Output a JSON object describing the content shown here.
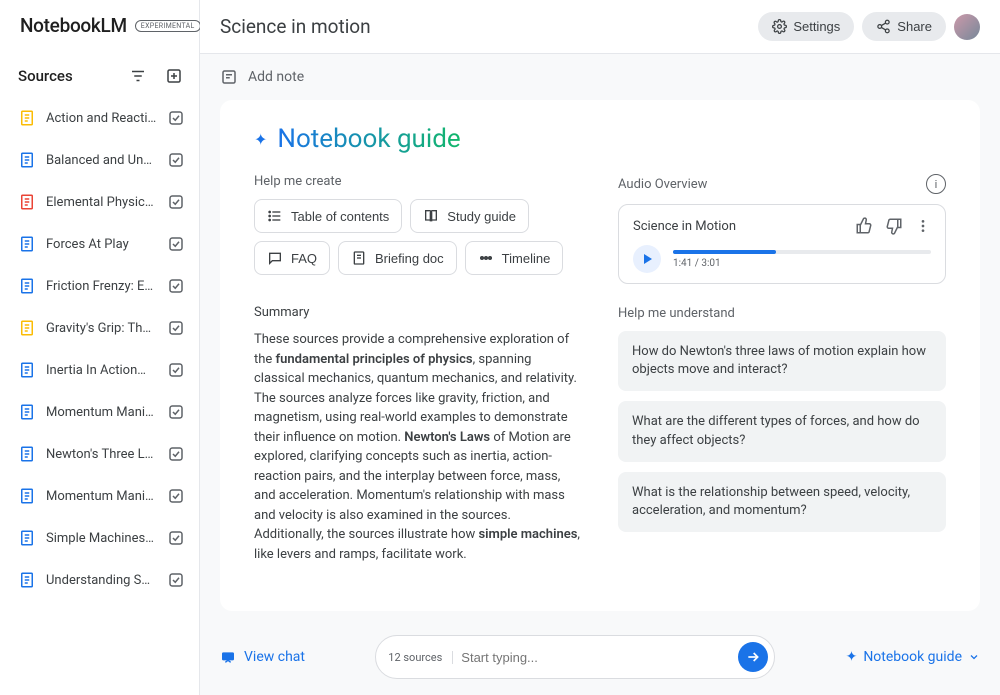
{
  "app": {
    "name": "NotebookLM",
    "badge": "EXPERIMENTAL"
  },
  "sidebar": {
    "heading": "Sources",
    "items": [
      {
        "label": "Action and Reaction",
        "color": "#fbbc04"
      },
      {
        "label": "Balanced and Unbalance…",
        "color": "#1a73e8"
      },
      {
        "label": "Elemental Physics, Third…",
        "color": "#ea4335"
      },
      {
        "label": "Forces At Play",
        "color": "#1a73e8"
      },
      {
        "label": "Friction Frenzy: Explorin…",
        "color": "#1a73e8"
      },
      {
        "label": "Gravity's Grip: The Forc…",
        "color": "#fbbc04"
      },
      {
        "label": "Inertia In Action…",
        "color": "#1a73e8"
      },
      {
        "label": "Momentum Mania: Inves…",
        "color": "#1a73e8"
      },
      {
        "label": "Newton's Three Laws…",
        "color": "#1a73e8"
      },
      {
        "label": "Momentum Mania: Inves…",
        "color": "#1a73e8"
      },
      {
        "label": "Simple Machines Make…",
        "color": "#1a73e8"
      },
      {
        "label": "Understanding Speed, Ve…",
        "color": "#1a73e8"
      }
    ]
  },
  "header": {
    "title": "Science in motion",
    "settings": "Settings",
    "share": "Share"
  },
  "addnote": "Add note",
  "notebook": {
    "title": "Notebook guide",
    "help_create": "Help me create",
    "chips": {
      "toc": "Table of contents",
      "study": "Study guide",
      "faq": "FAQ",
      "briefing": "Briefing doc",
      "timeline": "Timeline"
    },
    "summary_label": "Summary",
    "summary_p1a": "These sources provide a comprehensive exploration of the ",
    "summary_b1": "fundamental principles of physics",
    "summary_p1b": ", spanning classical mechanics, quantum mechanics, and relativity. The sources analyze forces like gravity, friction, and magnetism, using real-world examples to demonstrate their influence on motion. ",
    "summary_b2": "Newton's Laws",
    "summary_p1c": " of Motion are explored, clarifying concepts such as inertia, action-reaction pairs, and the interplay between force, mass, and acceleration. Momentum's relationship with mass and velocity is also examined in the sources. Additionally, the sources illustrate how ",
    "summary_b3": "simple machines",
    "summary_p1d": ", like levers and ramps, facilitate work."
  },
  "audio": {
    "overview_label": "Audio Overview",
    "track_name": "Science in Motion",
    "time": "1:41 / 3:01",
    "progress_pct": 40
  },
  "understand": {
    "label": "Help me understand",
    "q1": "How do Newton's three laws of motion explain how objects move and interact?",
    "q2": "What are the different types of forces, and how do they affect objects?",
    "q3": "What is the relationship between speed, velocity, acceleration, and momentum?"
  },
  "bottom": {
    "view_chat": "View chat",
    "sources_count": "12 sources",
    "placeholder": "Start typing...",
    "nb_guide": "Notebook guide"
  }
}
